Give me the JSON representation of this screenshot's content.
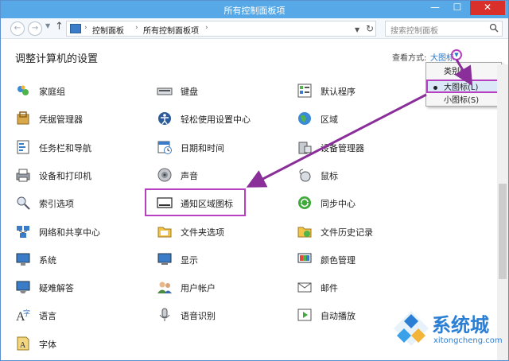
{
  "window": {
    "title": "所有控制面板项"
  },
  "titlebar": {
    "minimize": "—",
    "maximize": "☐",
    "close": "✕"
  },
  "nav": {
    "back": "←",
    "forward": "→",
    "up": "↑",
    "breadcrumb": [
      "控制面板",
      "所有控制面板项"
    ],
    "search_placeholder": "搜索控制面板"
  },
  "content": {
    "heading": "调整计算机的设置",
    "viewby_label": "查看方式:",
    "viewby_value": "大图标"
  },
  "viewby_menu": {
    "items": [
      {
        "label": "类别(C)",
        "selected": false
      },
      {
        "label": "大图标(L)",
        "selected": true
      },
      {
        "label": "小图标(S)",
        "selected": false
      }
    ]
  },
  "items": {
    "col1": [
      "家庭组",
      "凭据管理器",
      "任务栏和导航",
      "设备和打印机",
      "索引选项",
      "网络和共享中心",
      "系统",
      "疑难解答",
      "语言",
      "字体"
    ],
    "col2": [
      "键盘",
      "轻松使用设置中心",
      "日期和时间",
      "声音",
      "通知区域图标",
      "文件夹选项",
      "显示",
      "用户帐户",
      "语音识别"
    ],
    "col3": [
      "默认程序",
      "区域",
      "设备管理器",
      "鼠标",
      "同步中心",
      "文件历史记录",
      "颜色管理",
      "邮件",
      "自动播放"
    ]
  },
  "watermark": {
    "brand": "系统城",
    "site": "xitongcheng.com"
  },
  "colors": {
    "accent": "#b640c0",
    "titlebar": "#56a8e6",
    "link": "#2a78c8"
  }
}
